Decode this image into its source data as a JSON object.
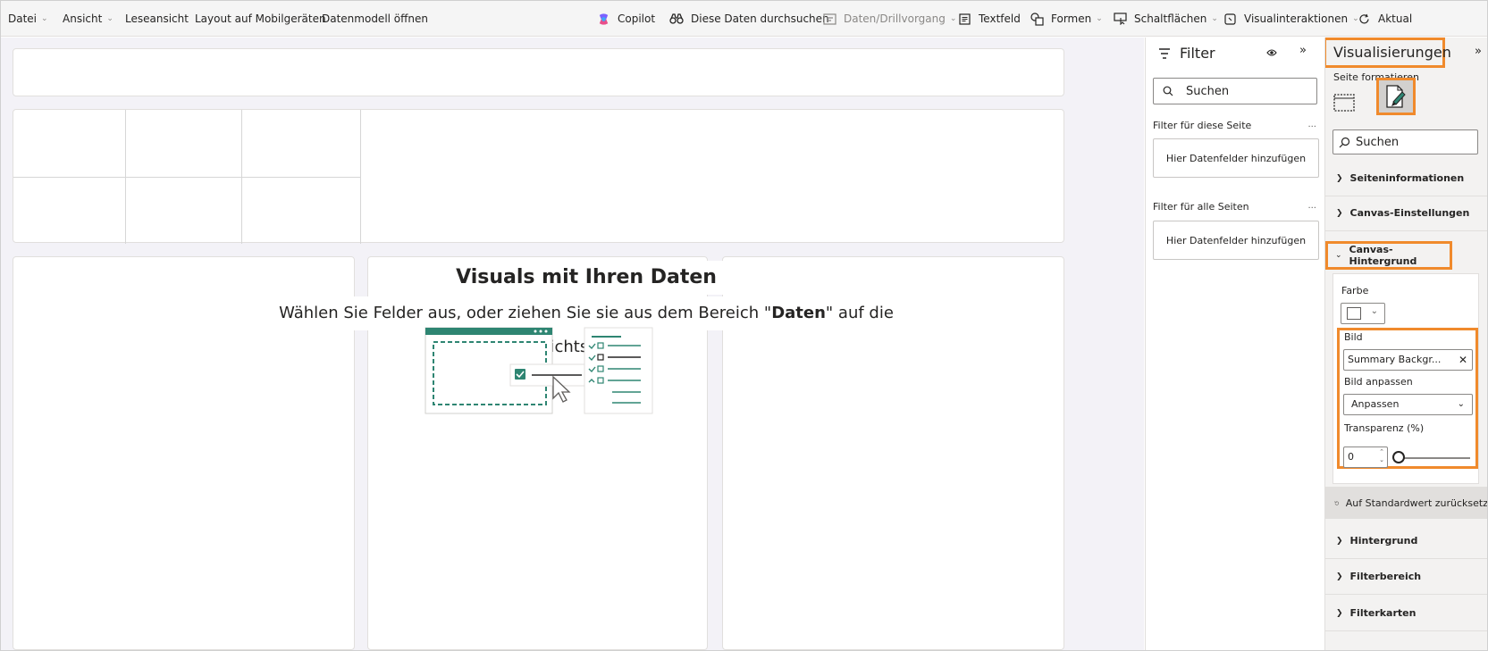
{
  "toolbar": {
    "items": [
      {
        "label": "Datei",
        "chevron": true
      },
      {
        "label": "Ansicht",
        "chevron": true
      },
      {
        "label": "Leseansicht",
        "chevron": false
      },
      {
        "label": "Layout auf Mobilgeräten",
        "chevron": false
      },
      {
        "label": "Datenmodell öffnen",
        "chevron": false
      },
      {
        "label": "Copilot",
        "icon": "copilot-icon"
      },
      {
        "label": "Diese Daten durchsuchen",
        "icon": "binoculars-icon"
      },
      {
        "label": "Daten/Drillvorgang",
        "icon": "drill-icon",
        "chevron": true,
        "disabled": true
      },
      {
        "label": "Textfeld",
        "icon": "textbox-icon"
      },
      {
        "label": "Formen",
        "icon": "shapes-icon",
        "chevron": true
      },
      {
        "label": "Schaltflächen",
        "icon": "buttons-icon",
        "chevron": true
      },
      {
        "label": "Visualinteraktionen",
        "icon": "interactions-icon",
        "chevron": true
      },
      {
        "label": "Aktual",
        "icon": "refresh-icon"
      }
    ]
  },
  "canvas": {
    "empty_title": "Visuals mit Ihren Daten erstellen",
    "empty_sub_before": "Wählen Sie Felder aus, oder ziehen Sie sie aus dem Bereich \"",
    "empty_sub_bold": "Daten",
    "empty_sub_after": "\" auf die Berichtscanvas."
  },
  "filter": {
    "title": "Filter",
    "search_placeholder": "Suchen",
    "page_label": "Filter für diese Seite",
    "page_drop": "Hier Datenfelder hinzufügen",
    "all_label": "Filter für alle Seiten",
    "all_drop": "Hier Datenfelder hinzufügen",
    "more": "..."
  },
  "viz": {
    "title": "Visualisierungen",
    "format_page": "Seite formatieren",
    "search_placeholder": "Suchen",
    "sections_top": [
      "Seiteninformationen",
      "Canvas-Einstellungen"
    ],
    "canvas_bg": "Canvas-Hintergrund",
    "color_label": "Farbe",
    "image_label": "Bild",
    "image_value": "Summary Backgr...",
    "fit_label": "Bild anpassen",
    "fit_value": "Anpassen",
    "transparency_label": "Transparenz (%)",
    "transparency_value": "0",
    "reset_label": "Auf Standardwert zurücksetz",
    "sections_bottom": [
      "Hintergrund",
      "Filterbereich",
      "Filterkarten"
    ]
  },
  "colors": {
    "highlight": "#f08a2c",
    "accent": "#2e8572"
  }
}
